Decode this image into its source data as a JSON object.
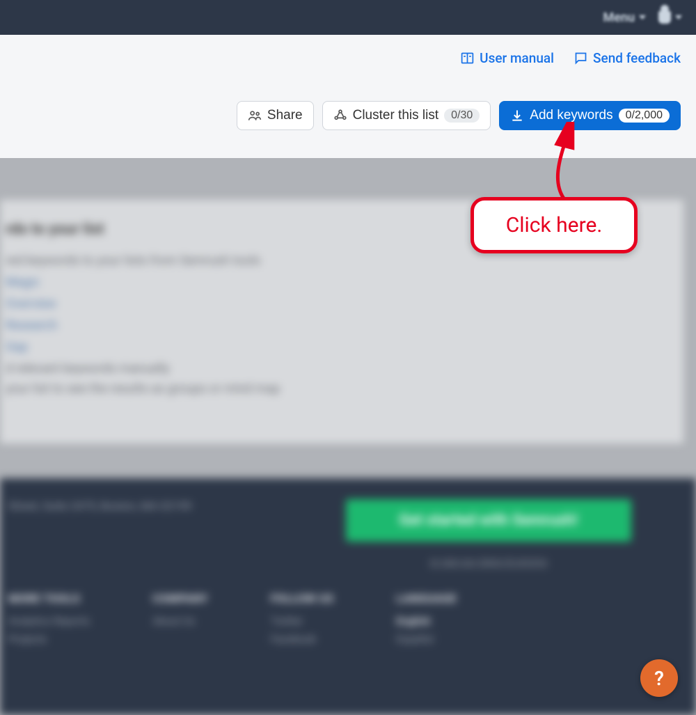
{
  "topbar": {
    "menu_label": "Menu"
  },
  "header": {
    "user_manual": "User manual",
    "send_feedback": "Send feedback"
  },
  "actions": {
    "share": "Share",
    "cluster": "Cluster this list",
    "cluster_count": "0/30",
    "add_keywords": "Add keywords",
    "add_count": "0/2,000"
  },
  "callout": {
    "text": "Click here."
  },
  "blurred": {
    "heading": "rds to your list",
    "p1": "red keywords to your lists from Semrush tools",
    "l1": "Magic",
    "l2": "Overview",
    "l3": "Research",
    "l4": "Gap",
    "p2": "d relevant keywords manually",
    "p3": "your list to see the results as groups or mind map"
  },
  "footer": {
    "address": "Street, Suite 2475, Boston, MA 02199",
    "cta": "Get started with Semrush!",
    "sublink": "or see our plans & pricing",
    "col1_h": "MORE TOOLS",
    "col1_a": "Analytics Reports",
    "col1_b": "Projects",
    "col2_h": "COMPANY",
    "col2_a": "About Us",
    "col3_h": "FOLLOW US",
    "col3_a": "Twitter",
    "col3_b": "Facebook",
    "col4_h": "LANGUAGE",
    "col4_a": "English",
    "col4_b": "Español"
  },
  "help": {
    "glyph": "?"
  }
}
